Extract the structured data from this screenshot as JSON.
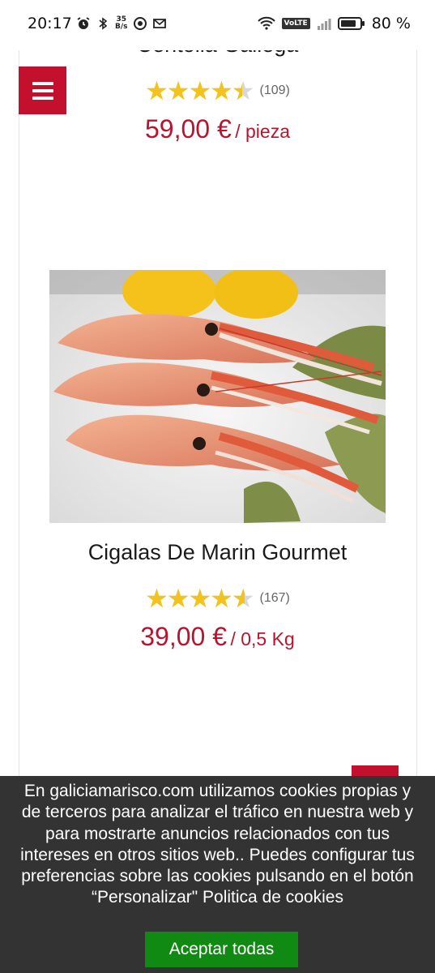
{
  "status_bar": {
    "time": "20:17",
    "speed_value": "35",
    "speed_unit": "B/s",
    "volte": "VoLTE",
    "battery": "80 %"
  },
  "products": [
    {
      "name": "Centolla Gallega",
      "rating_count": "(109)",
      "rating_stars": 4.5,
      "price": "59,00 €",
      "unit": "/ pieza"
    },
    {
      "name": "Cigalas De Marin Gourmet",
      "rating_count": "(167)",
      "rating_stars": 4.6,
      "price": "39,00 €",
      "unit": "/ 0,5 Kg"
    }
  ],
  "cookie_banner": {
    "text": "En galiciamarisco.com utilizamos cookies propias y de terceros para analizar el tráfico en nuestra web y para mostrarte anuncios relacionados con tus intereses en otros sitios web.. Puedes configurar tus preferencias sobre las cookies pulsando en el botón “Personalizar\" Politica de cookies",
    "accept_label": "Aceptar todas"
  },
  "colors": {
    "brand_red": "#c3102c",
    "price_red": "#b8142e",
    "star_gold": "#f2c31a",
    "accept_green": "#118a13",
    "banner_bg": "#333333"
  }
}
